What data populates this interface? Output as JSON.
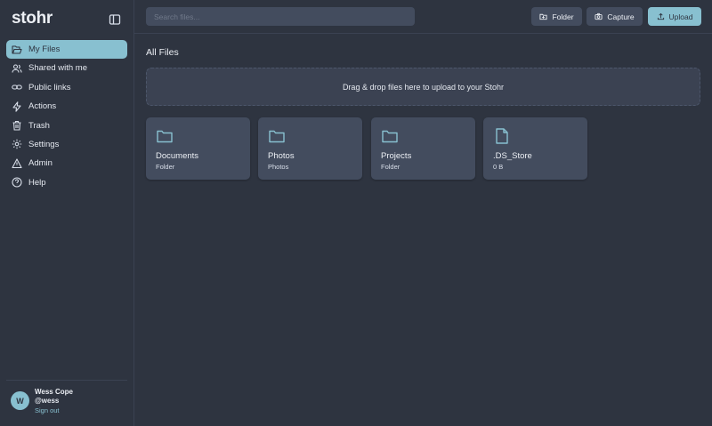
{
  "brand": "stohr",
  "sidebar": {
    "items": [
      {
        "label": "My Files",
        "icon": "folder-open-icon",
        "active": true
      },
      {
        "label": "Shared with me",
        "icon": "users-icon"
      },
      {
        "label": "Public links",
        "icon": "link-icon"
      },
      {
        "label": "Actions",
        "icon": "lightning-icon"
      },
      {
        "label": "Trash",
        "icon": "trash-icon"
      },
      {
        "label": "Settings",
        "icon": "gear-icon"
      },
      {
        "label": "Admin",
        "icon": "warning-icon"
      },
      {
        "label": "Help",
        "icon": "help-circle-icon"
      }
    ]
  },
  "user": {
    "initial": "W",
    "name": "Wess Cope",
    "handle": "@wess",
    "signout": "Sign out"
  },
  "search": {
    "placeholder": "Search files..."
  },
  "toolbar": {
    "folder_label": "Folder",
    "capture_label": "Capture",
    "upload_label": "Upload"
  },
  "main": {
    "title": "All Files",
    "dropzone_text": "Drag & drop files here to upload to your Stohr",
    "items": [
      {
        "name": "Documents",
        "sub": "Folder",
        "icon": "folder-icon"
      },
      {
        "name": "Photos",
        "sub": "Photos",
        "icon": "folder-icon"
      },
      {
        "name": "Projects",
        "sub": "Folder",
        "icon": "folder-icon"
      },
      {
        "name": ".DS_Store",
        "sub": "0 B",
        "icon": "file-icon"
      }
    ]
  },
  "colors": {
    "background": "#2e3440",
    "surface": "#434c5e",
    "accent": "#88c0d0"
  }
}
